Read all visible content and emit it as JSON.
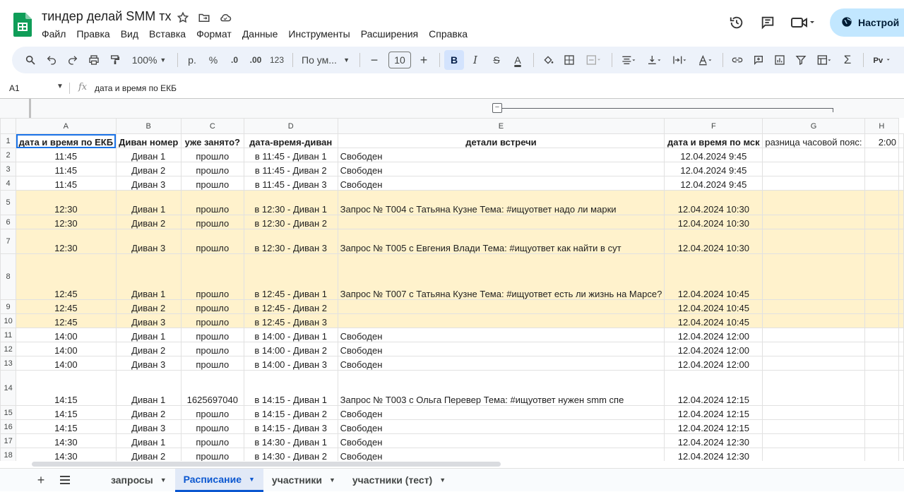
{
  "document": {
    "title": "тиндер делай SMM тх"
  },
  "menu": [
    "Файл",
    "Правка",
    "Вид",
    "Вставка",
    "Формат",
    "Данные",
    "Инструменты",
    "Расширения",
    "Справка"
  ],
  "share": {
    "label": "Настрой"
  },
  "toolbar": {
    "zoom": "100%",
    "currency": "р.",
    "percent": "%",
    "dec_minus": ".0",
    "dec_plus": ".00",
    "number_format": "123",
    "font": "По ум...",
    "font_size": "10",
    "bold": "B",
    "italic": "I",
    "strike": "S",
    "text_color": "A"
  },
  "formula_bar": {
    "cell_ref": "A1",
    "fx": "fx",
    "content": "дата и время по ЕКБ"
  },
  "columns": [
    "A",
    "B",
    "C",
    "D",
    "E",
    "F",
    "G",
    "H"
  ],
  "rows": [
    {
      "n": "1",
      "busy": false,
      "cells": [
        "дата и время по ЕКБ",
        "Диван номер",
        "уже занято?",
        "дата-время-диван",
        "детали встречи",
        "дата и время по мск",
        "разница часовой пояс:",
        "2:00"
      ]
    },
    {
      "n": "2",
      "busy": false,
      "cells": [
        "11:45",
        "Диван 1",
        "прошло",
        "в 11:45 - Диван 1",
        "Свободен",
        "12.04.2024 9:45",
        "",
        ""
      ]
    },
    {
      "n": "3",
      "busy": false,
      "cells": [
        "11:45",
        "Диван 2",
        "прошло",
        "в 11:45 - Диван 2",
        "Свободен",
        "12.04.2024 9:45",
        "",
        ""
      ]
    },
    {
      "n": "4",
      "busy": false,
      "cells": [
        "11:45",
        "Диван 3",
        "прошло",
        "в 11:45 - Диван 3",
        "Свободен",
        "12.04.2024 9:45",
        "",
        ""
      ]
    },
    {
      "n": "5",
      "busy": true,
      "cells": [
        "12:30",
        "Диван 1",
        "прошло",
        "в 12:30 - Диван 1",
        "Запрос № T004 с Татьяна Кузне\nТема: #ищуответ надо ли марки",
        "12.04.2024 10:30",
        "",
        ""
      ]
    },
    {
      "n": "6",
      "busy": true,
      "cells": [
        "12:30",
        "Диван 2",
        "прошло",
        "в 12:30 - Диван 2",
        "",
        "12.04.2024 10:30",
        "",
        ""
      ]
    },
    {
      "n": "7",
      "busy": true,
      "cells": [
        "12:30",
        "Диван 3",
        "прошло",
        "в 12:30 - Диван 3",
        "Запрос № T005 с Евгения Влади\nТема: #ищуответ как найти в сут",
        "12.04.2024 10:30",
        "",
        ""
      ]
    },
    {
      "n": "8",
      "busy": true,
      "cells": [
        "12:45",
        "Диван 1",
        "прошло",
        "в 12:45 - Диван 1",
        "Запрос № T007 с Татьяна Кузне\n\nТема: #ищуответ\nесть ли жизнь на Марсе?",
        "12.04.2024 10:45",
        "",
        ""
      ]
    },
    {
      "n": "9",
      "busy": true,
      "cells": [
        "12:45",
        "Диван 2",
        "прошло",
        "в 12:45 - Диван 2",
        "",
        "12.04.2024 10:45",
        "",
        ""
      ]
    },
    {
      "n": "10",
      "busy": true,
      "cells": [
        "12:45",
        "Диван 3",
        "прошло",
        "в 12:45 - Диван 3",
        "",
        "12.04.2024 10:45",
        "",
        ""
      ]
    },
    {
      "n": "11",
      "busy": false,
      "cells": [
        "14:00",
        "Диван 1",
        "прошло",
        "в 14:00 - Диван 1",
        "Свободен",
        "12.04.2024 12:00",
        "",
        ""
      ]
    },
    {
      "n": "12",
      "busy": false,
      "cells": [
        "14:00",
        "Диван 2",
        "прошло",
        "в 14:00 - Диван 2",
        "Свободен",
        "12.04.2024 12:00",
        "",
        ""
      ]
    },
    {
      "n": "13",
      "busy": false,
      "cells": [
        "14:00",
        "Диван 3",
        "прошло",
        "в 14:00 - Диван 3",
        "Свободен",
        "12.04.2024 12:00",
        "",
        ""
      ]
    },
    {
      "n": "14",
      "busy": false,
      "cells": [
        "14:15",
        "Диван 1",
        "1625697040",
        "в 14:15 - Диван 1",
        "Запрос № T003 с Ольга Перевер\n\nТема: #ищуответ нужен smm спе",
        "12.04.2024 12:15",
        "",
        ""
      ]
    },
    {
      "n": "15",
      "busy": false,
      "cells": [
        "14:15",
        "Диван 2",
        "прошло",
        "в 14:15 - Диван 2",
        "Свободен",
        "12.04.2024 12:15",
        "",
        ""
      ]
    },
    {
      "n": "16",
      "busy": false,
      "cells": [
        "14:15",
        "Диван 3",
        "прошло",
        "в 14:15 - Диван 3",
        "Свободен",
        "12.04.2024 12:15",
        "",
        ""
      ]
    },
    {
      "n": "17",
      "busy": false,
      "cells": [
        "14:30",
        "Диван 1",
        "прошло",
        "в 14:30 - Диван 1",
        "Свободен",
        "12.04.2024 12:30",
        "",
        ""
      ]
    },
    {
      "n": "18",
      "busy": false,
      "cells": [
        "14:30",
        "Диван 2",
        "прошло",
        "в 14:30 - Диван 2",
        "Свободен",
        "12.04.2024 12:30",
        "",
        ""
      ]
    }
  ],
  "sheets": [
    {
      "name": "запросы",
      "active": false
    },
    {
      "name": "Расписание",
      "active": true
    },
    {
      "name": "участники",
      "active": false
    },
    {
      "name": "участники (тест)",
      "active": false
    }
  ],
  "colors": {
    "busy_fill": "#fff2cc",
    "accent": "#0b57d0",
    "share_bg": "#c2e7ff",
    "toolbar_bg": "#edf2fa"
  }
}
